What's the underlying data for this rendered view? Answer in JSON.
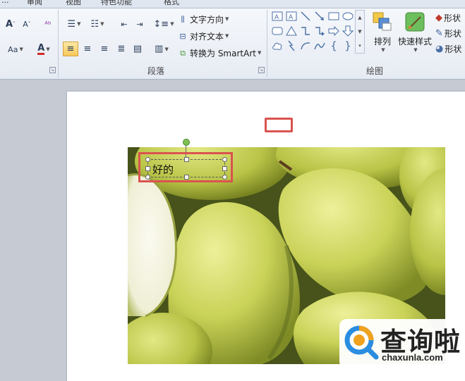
{
  "tabs": [
    "...",
    "审阅",
    "视图",
    "特色功能",
    "格式"
  ],
  "paragraph": {
    "label": "段落",
    "text_direction": "文字方向",
    "align_text": "对齐文本",
    "convert_smartart": "转换为 SmartArt"
  },
  "drawing": {
    "label": "绘图",
    "arrange": "排列",
    "quick_styles": "快速样式",
    "shape_fill": "形状",
    "shape_outline": "形状",
    "shape_effects": "形状"
  },
  "font": {
    "grow_font": "A",
    "shrink_font": "A",
    "change_case": "Aa",
    "font_color": "A"
  },
  "slide": {
    "textbox_text": "好的"
  },
  "watermark": {
    "name": "查询啦",
    "domain": "chaxunla.com"
  }
}
